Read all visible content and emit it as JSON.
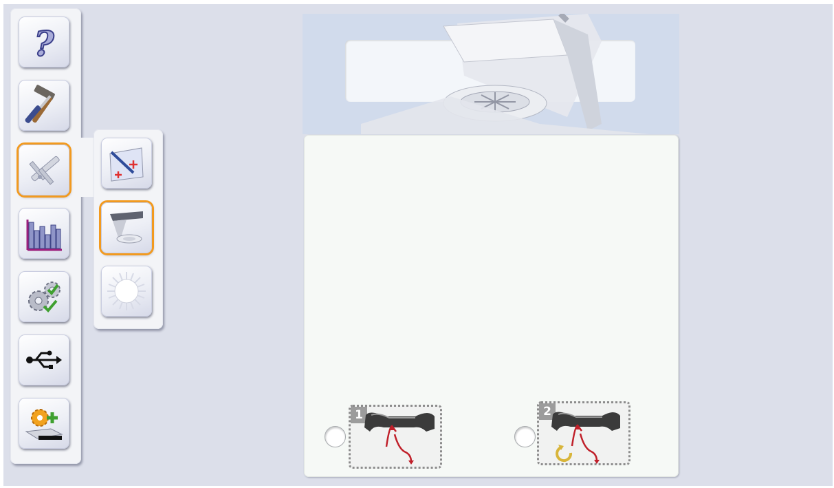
{
  "toolbar": {
    "items": [
      {
        "icon": "help-icon"
      },
      {
        "icon": "tools-icon"
      },
      {
        "icon": "calipers-icon",
        "active": true
      },
      {
        "icon": "statistics-chart-icon"
      },
      {
        "icon": "settings-gears-icon"
      },
      {
        "icon": "usb-icon"
      },
      {
        "icon": "add-configuration-icon"
      }
    ]
  },
  "subtoolbar": {
    "items": [
      {
        "icon": "calibration-icon"
      },
      {
        "icon": "sample-holder-icon",
        "active": true
      },
      {
        "icon": "light-source-icon"
      }
    ]
  },
  "header": {
    "image": "instrument-device-image"
  },
  "options": [
    {
      "number": "1",
      "icon": "holder-insert-icon",
      "selected": false
    },
    {
      "number": "2",
      "icon": "holder-insert-rotate-icon",
      "selected": false
    }
  ],
  "colors": {
    "active_outline": "#f29a1f",
    "background": "#dcdfea",
    "panel": "#f6f9f6",
    "arrow_red": "#c0202a",
    "rotate_yellow": "#d8b53a"
  }
}
